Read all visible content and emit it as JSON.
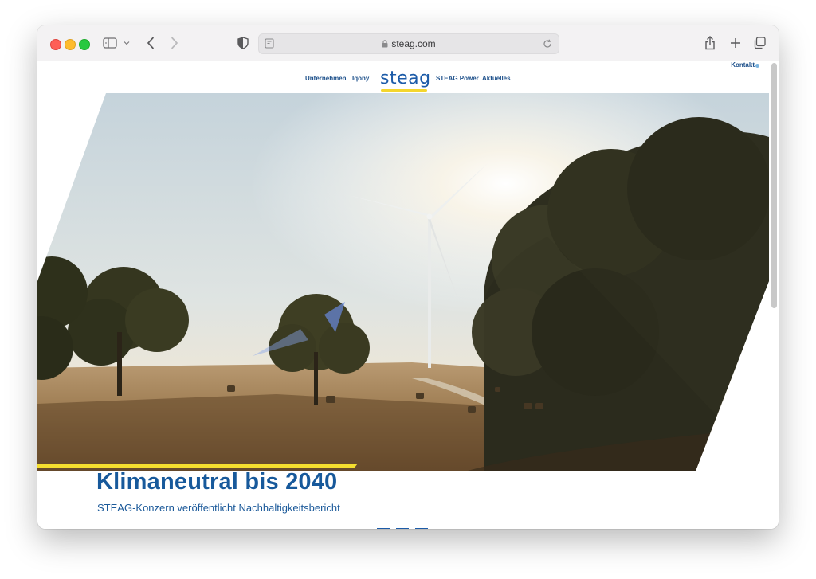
{
  "browser": {
    "url": "steag.com",
    "controls": [
      "sidebar-toggle",
      "back",
      "forward",
      "share",
      "new-tab",
      "tab-overview"
    ]
  },
  "nav": {
    "items": [
      {
        "label": "Unternehmen"
      },
      {
        "label": "Iqony"
      },
      {
        "label": "STEAG Power"
      },
      {
        "label": "Aktuelles"
      }
    ],
    "logo": "steag",
    "contact": "Kontakt"
  },
  "hero": {
    "image_description_icon": "wind-turbine-landscape-image",
    "headline": "Klimaneutral bis 2040",
    "subline": "STEAG-Konzern veröffentlicht Nachhaltigkeitsbericht"
  },
  "colors": {
    "brand_blue": "#1c5ba8",
    "accent_yellow": "#f4de2f"
  }
}
